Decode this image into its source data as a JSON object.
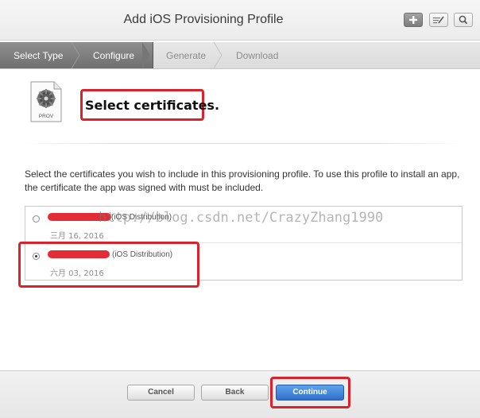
{
  "header": {
    "title": "Add iOS Provisioning Profile",
    "buttons": [
      {
        "icon": "plus-icon"
      },
      {
        "icon": "edit-icon"
      },
      {
        "icon": "search-icon"
      }
    ]
  },
  "steps": [
    {
      "label": "Select Type",
      "state": "done"
    },
    {
      "label": "Configure",
      "state": "active"
    },
    {
      "label": "Generate",
      "state": "pending"
    },
    {
      "label": "Download",
      "state": "pending"
    }
  ],
  "intro": {
    "icon_label": "PROV",
    "heading": "Select certificates."
  },
  "description": "Select the certificates you wish to include in this provisioning profile. To use this profile to install an app, the certificate the app was signed with must be included.",
  "certificates": [
    {
      "type": "(iOS Distribution)",
      "date": "三月 16, 2016",
      "selected": false
    },
    {
      "type": "(iOS Distribution)",
      "date": "六月 03, 2016",
      "selected": true
    }
  ],
  "watermark": "http://blog.csdn.net/CrazyZhang1990",
  "footer": {
    "cancel_label": "Cancel",
    "back_label": "Back",
    "continue_label": "Continue"
  },
  "colors": {
    "accent": "#2f6fcb",
    "annotation": "#d9232a"
  }
}
